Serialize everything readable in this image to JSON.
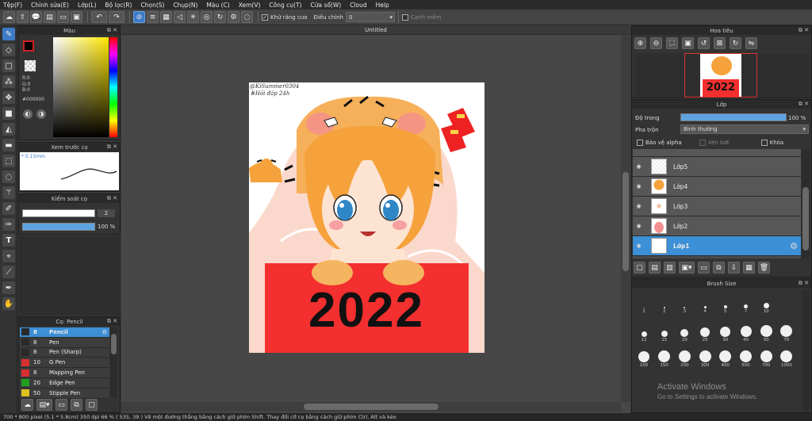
{
  "menu": [
    "Tệp(F)",
    "Chỉnh sửa(E)",
    "Lớp(L)",
    "Bộ lọc(R)",
    "Chọn(S)",
    "Chụp(N)",
    "Màu (C)",
    "Xem(V)",
    "Công cụ(T)",
    "Cửa sổ(W)",
    "Cloud",
    "Help"
  ],
  "toolbar": {
    "antialias_label": "Khử răng cưa",
    "adjust_label": "Điều chỉnh",
    "adjust_value": "0",
    "smooth_label": "Cạnh mềm"
  },
  "color_panel": {
    "title": "Màu",
    "r": "R:0",
    "g": "G:0",
    "b": "B:0",
    "hex": "#000000",
    "primary_color": "#000000",
    "secondary_color": "#ffffff"
  },
  "preview_panel": {
    "title": "Xem trước cọ",
    "size_text": "* 0.15mm"
  },
  "brush_control": {
    "title": "Kiểm soát cọ",
    "size_value": "2",
    "opacity_value": "100 %",
    "opacity_fraction": 1.0
  },
  "pen_panel": {
    "title": "Cọ: Pencil",
    "items": [
      {
        "size": "8",
        "name": "Pencil",
        "color": "#2a2a2a",
        "selected": true
      },
      {
        "size": "8",
        "name": "Pen",
        "color": "#2a2a2a"
      },
      {
        "size": "8",
        "name": "Pen (Sharp)",
        "color": "#2a2a2a"
      },
      {
        "size": "10",
        "name": "G Pen",
        "color": "#d83030"
      },
      {
        "size": "8",
        "name": "Mapping Pen",
        "color": "#d83030"
      },
      {
        "size": "20",
        "name": "Edge Pen",
        "color": "#20a020"
      },
      {
        "size": "50",
        "name": "Stipple Pen",
        "color": "#e0c020"
      }
    ]
  },
  "canvas": {
    "tab_title": "Untitled",
    "signature_line1": "@KiSummer0304",
    "signature_line2": "#Hỏi đáp 24h",
    "year_text": "2022"
  },
  "navigator": {
    "title": "Hoa tiêu",
    "thumb_year": "2022"
  },
  "layer_panel": {
    "title": "Lớp",
    "opacity_label": "Độ trong",
    "opacity_value": "100 %",
    "opacity_fraction": 1.0,
    "blend_label": "Pha trộn",
    "blend_value": "Bình thường",
    "protect_alpha": "Bảo vệ alpha",
    "clipping": "Xén bớt",
    "lock": "Khóa",
    "layers": [
      {
        "name": "Lớp5"
      },
      {
        "name": "Lớp4"
      },
      {
        "name": "Lớp3"
      },
      {
        "name": "Lớp2"
      },
      {
        "name": "Lớp1",
        "selected": true
      }
    ]
  },
  "brush_size": {
    "title": "Brush Size",
    "rows": [
      [
        "1",
        "2",
        "3",
        "4",
        "5",
        "7",
        "10"
      ],
      [
        "12",
        "15",
        "20",
        "25",
        "30",
        "40",
        "50",
        "70"
      ],
      [
        "100",
        "150",
        "200",
        "300",
        "400",
        "500",
        "700",
        "1000"
      ]
    ]
  },
  "watermark": {
    "line1": "Activate Windows",
    "line2": "Go to Settings to activate Windows."
  },
  "status": {
    "text": "700 * 800 pixel   (5.1 * 5.8cm)   350 dpi   66 %   ( 535, 39 )   Vẽ một đường thẳng bằng cách giữ phím Shift. Thay đổi cỡ cọ bằng cách giữ phím Ctrl, Alt và kéo"
  }
}
